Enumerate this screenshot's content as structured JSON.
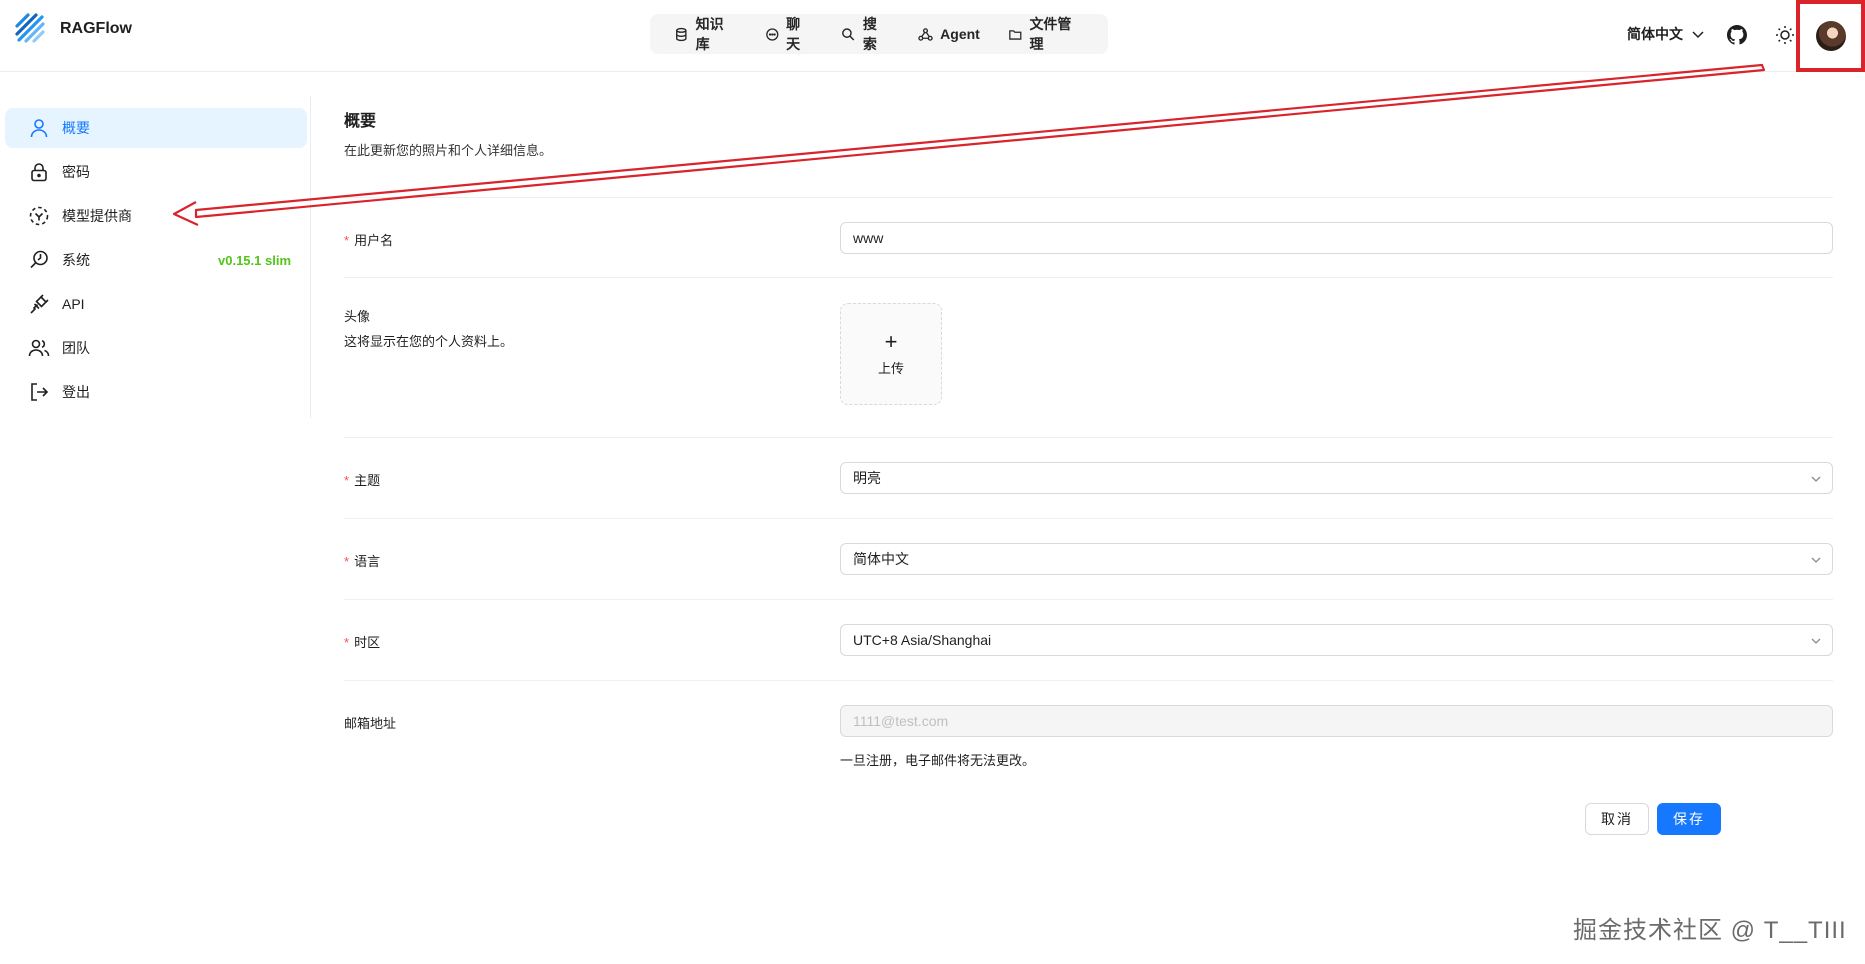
{
  "app": {
    "name": "RAGFlow"
  },
  "nav": [
    {
      "label": "知识库",
      "icon": "database-icon"
    },
    {
      "label": "聊天",
      "icon": "chat-icon"
    },
    {
      "label": "搜索",
      "icon": "search-icon"
    },
    {
      "label": "Agent",
      "icon": "agent-icon"
    },
    {
      "label": "文件管理",
      "icon": "folder-icon"
    }
  ],
  "header": {
    "language": "简体中文"
  },
  "sidebar": {
    "items": [
      {
        "label": "概要",
        "icon": "user-icon"
      },
      {
        "label": "密码",
        "icon": "lock-icon"
      },
      {
        "label": "模型提供商",
        "icon": "model-icon"
      },
      {
        "label": "系统",
        "icon": "system-icon",
        "badge": "v0.15.1 slim"
      },
      {
        "label": "API",
        "icon": "plug-icon"
      },
      {
        "label": "团队",
        "icon": "team-icon"
      },
      {
        "label": "登出",
        "icon": "logout-icon"
      }
    ]
  },
  "main": {
    "title": "概要",
    "description": "在此更新您的照片和个人详细信息。",
    "username": {
      "label": "用户名",
      "value": "www"
    },
    "avatar": {
      "label": "头像",
      "sub": "这将显示在您的个人资料上。",
      "upload": "上传"
    },
    "theme": {
      "label": "主题",
      "value": "明亮"
    },
    "language": {
      "label": "语言",
      "value": "简体中文"
    },
    "timezone": {
      "label": "时区",
      "value": "UTC+8 Asia/Shanghai"
    },
    "email": {
      "label": "邮箱地址",
      "value": "1111@test.com",
      "hint": "一旦注册，电子邮件将无法更改。"
    },
    "buttons": {
      "cancel": "取消",
      "save": "保存"
    }
  },
  "watermark": "掘金技术社区 @ T__TIII",
  "colors": {
    "accent": "#1677ff",
    "active_bg": "#e6f4ff",
    "version": "#52c41a",
    "annotation": "#d9242b"
  }
}
